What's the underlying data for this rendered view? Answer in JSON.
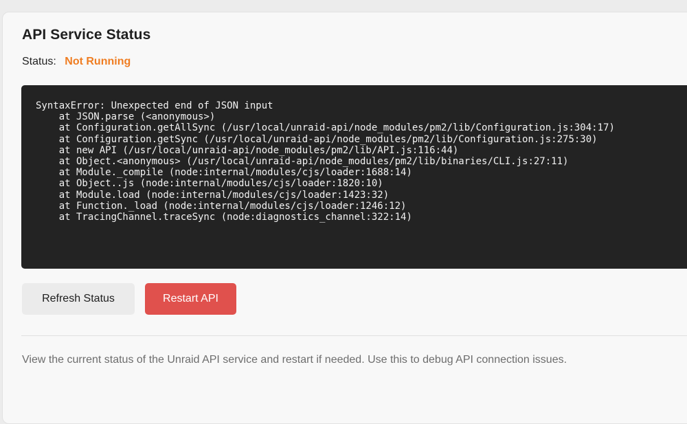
{
  "panel": {
    "title": "API Service Status",
    "status_label": "Status:",
    "status_value": "Not Running",
    "status_color": "#ef7d22",
    "log_lines": [
      "SyntaxError: Unexpected end of JSON input",
      "    at JSON.parse (<anonymous>)",
      "    at Configuration.getAllSync (/usr/local/unraid-api/node_modules/pm2/lib/Configuration.js:304:17)",
      "    at Configuration.getSync (/usr/local/unraid-api/node_modules/pm2/lib/Configuration.js:275:30)",
      "    at new API (/usr/local/unraid-api/node_modules/pm2/lib/API.js:116:44)",
      "    at Object.<anonymous> (/usr/local/unraid-api/node_modules/pm2/lib/binaries/CLI.js:27:11)",
      "    at Module._compile (node:internal/modules/cjs/loader:1688:14)",
      "    at Object..js (node:internal/modules/cjs/loader:1820:10)",
      "    at Module.load (node:internal/modules/cjs/loader:1423:32)",
      "    at Function._load (node:internal/modules/cjs/loader:1246:12)",
      "    at TracingChannel.traceSync (node:diagnostics_channel:322:14)"
    ],
    "buttons": {
      "refresh_label": "Refresh Status",
      "restart_label": "Restart API",
      "restart_color": "#e0514d"
    },
    "description": "View the current status of the Unraid API service and restart if needed. Use this to debug API connection issues."
  }
}
